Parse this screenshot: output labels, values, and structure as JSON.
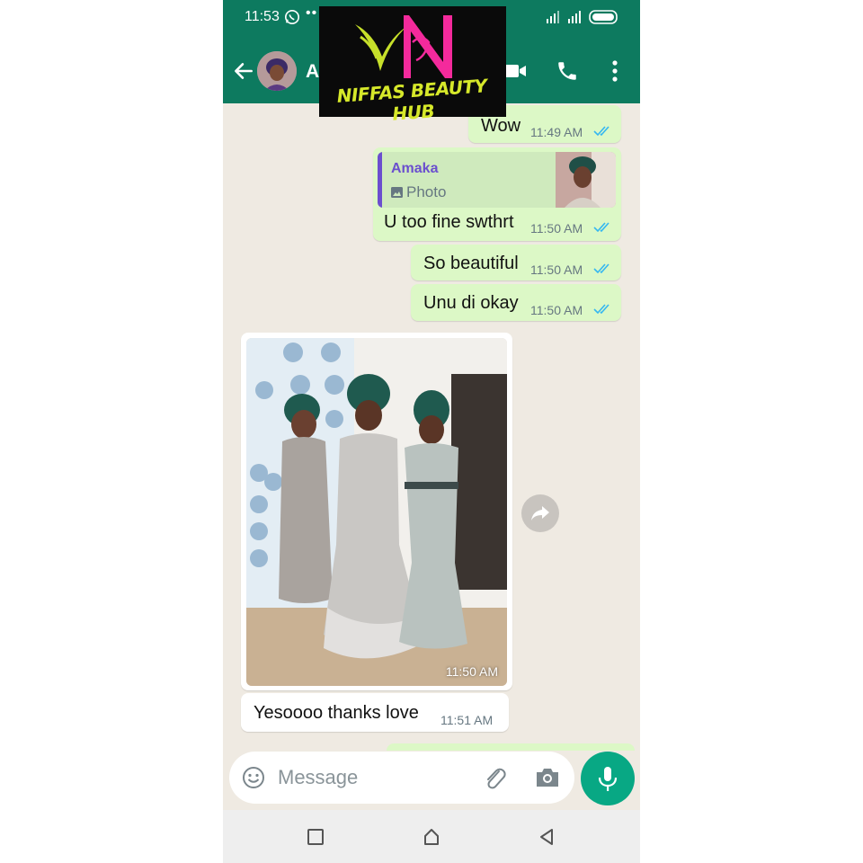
{
  "status_bar": {
    "time": "11:53",
    "dots": "••"
  },
  "header": {
    "contact_name": "Am",
    "accent": "#0d7a5f"
  },
  "logo": {
    "text": "NIFFAS BEAUTY HUB",
    "monogram": "VN"
  },
  "messages": [
    {
      "direction": "out",
      "text": "Wow",
      "time": "11:49 AM",
      "status": "read"
    },
    {
      "direction": "out",
      "quote_name": "Amaka",
      "quote_type": "Photo",
      "text": "U too fine swthrt",
      "time": "11:50 AM",
      "status": "read"
    },
    {
      "direction": "out",
      "text": "So beautiful",
      "time": "11:50 AM",
      "status": "read"
    },
    {
      "direction": "out",
      "text": "Unu di okay",
      "time": "11:50 AM",
      "status": "read"
    },
    {
      "direction": "in",
      "type": "photo",
      "time": "11:50 AM"
    },
    {
      "direction": "in",
      "text": "Yesoooo thanks love",
      "time": "11:51 AM"
    }
  ],
  "input": {
    "placeholder": "Message"
  },
  "colors": {
    "outgoing_bubble": "#dcf8c6",
    "incoming_bubble": "#ffffff",
    "chat_bg": "#efeae2",
    "read_ticks": "#34b7f1",
    "mic_button": "#08a884",
    "quote_name": "#6b4fce"
  }
}
